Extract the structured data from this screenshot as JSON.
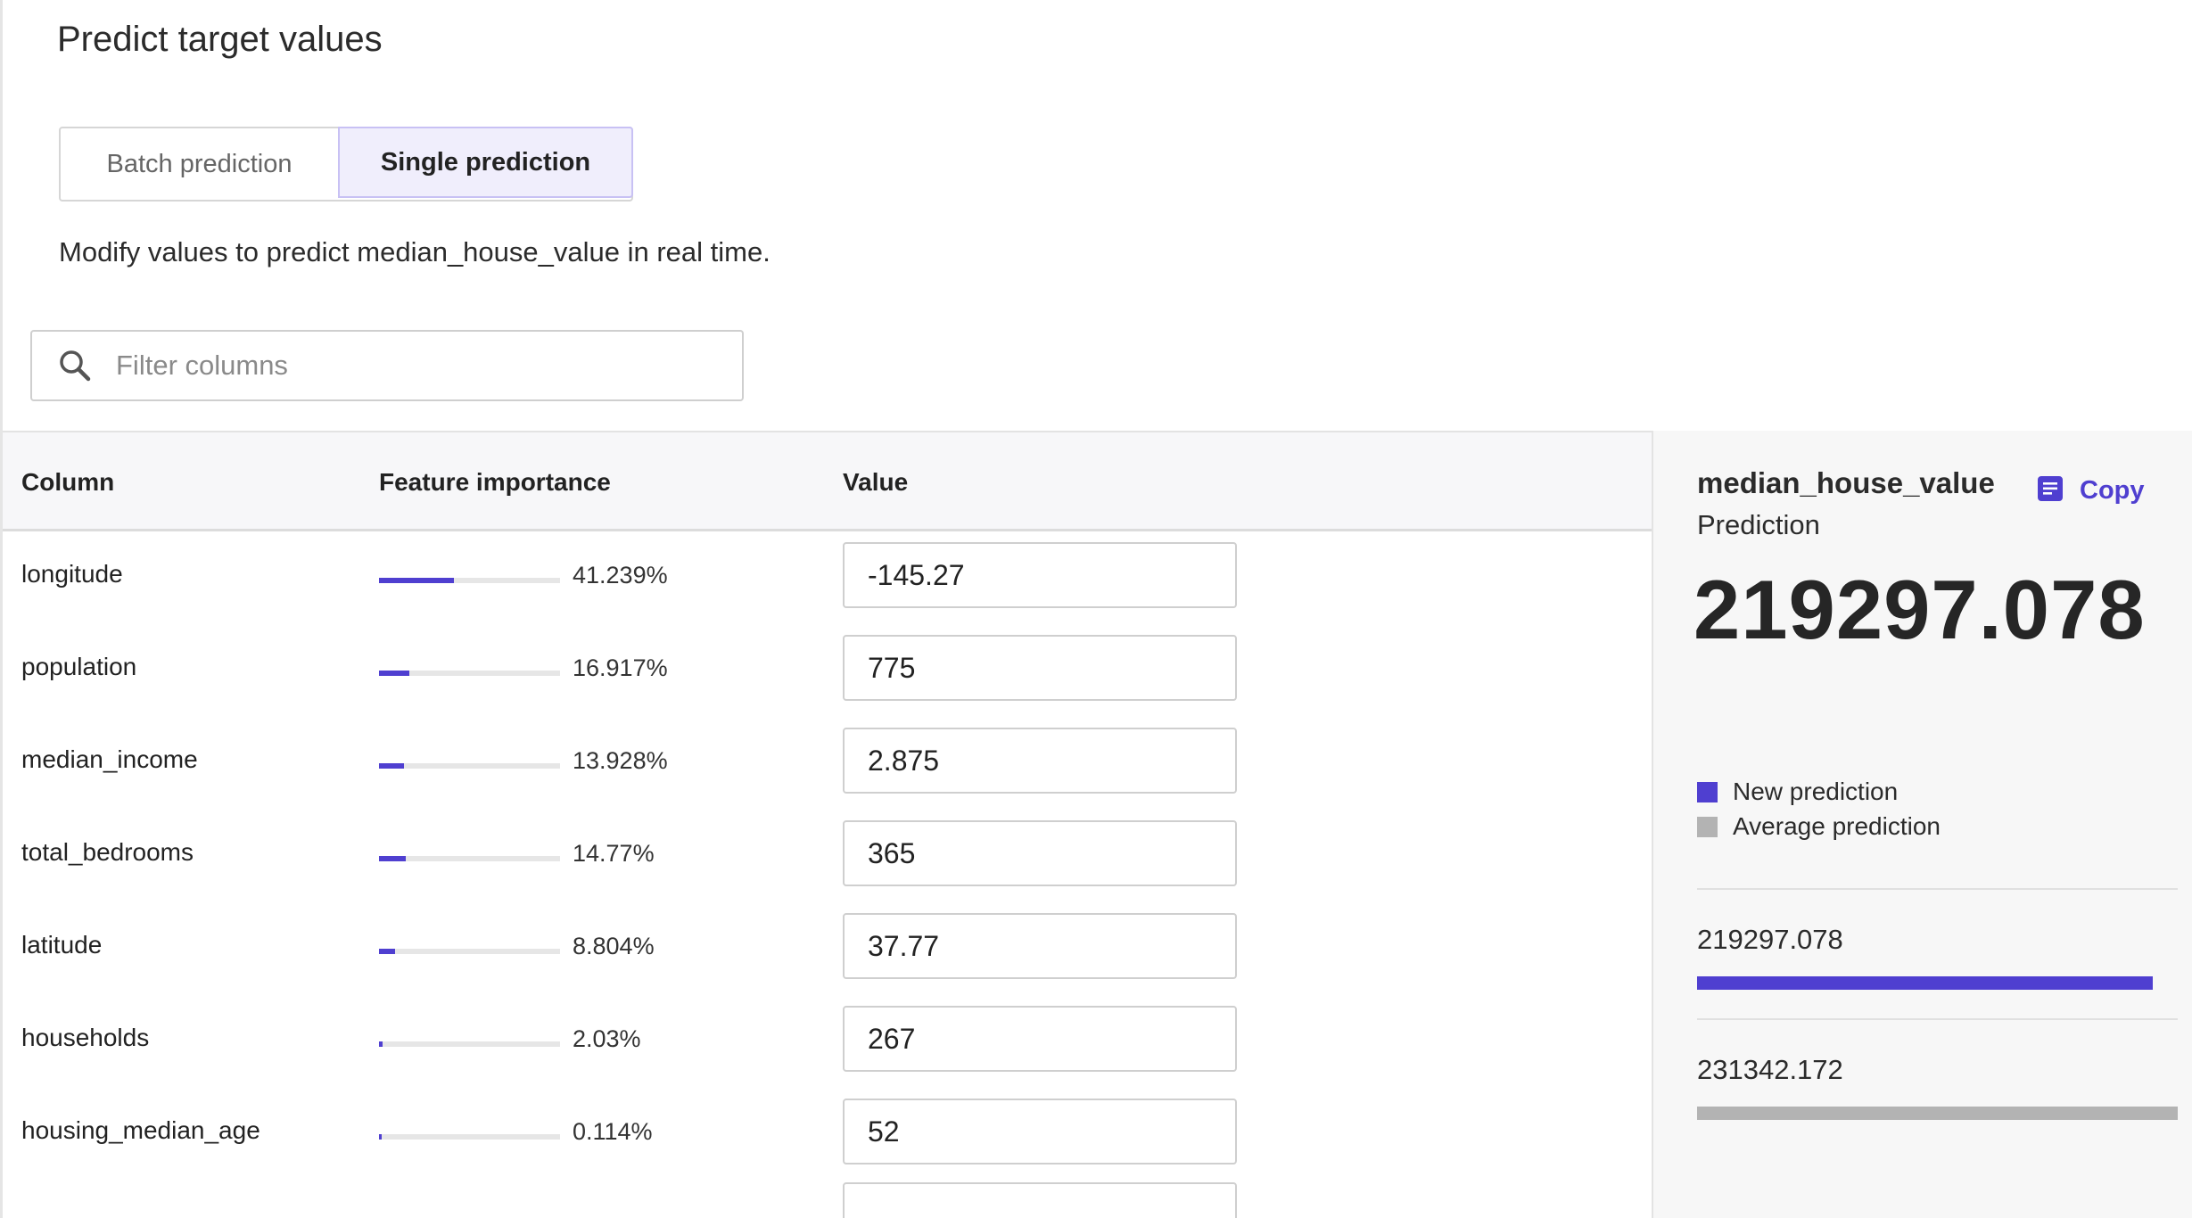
{
  "header": {
    "title": "Predict target values"
  },
  "mode_tabs": {
    "batch_label": "Batch prediction",
    "single_label": "Single prediction",
    "selected": "Single prediction"
  },
  "description": "Modify values to predict median_house_value in real time.",
  "filter": {
    "placeholder": "Filter columns",
    "value": ""
  },
  "table": {
    "headers": {
      "column": "Column",
      "importance": "Feature importance",
      "value": "Value"
    },
    "rows": [
      {
        "name": "longitude",
        "importance_pct": 41.239,
        "importance_label": "41.239%",
        "value": "-145.27"
      },
      {
        "name": "population",
        "importance_pct": 16.917,
        "importance_label": "16.917%",
        "value": "775"
      },
      {
        "name": "median_income",
        "importance_pct": 13.928,
        "importance_label": "13.928%",
        "value": "2.875"
      },
      {
        "name": "total_bedrooms",
        "importance_pct": 14.77,
        "importance_label": "14.77%",
        "value": "365"
      },
      {
        "name": "latitude",
        "importance_pct": 8.804,
        "importance_label": "8.804%",
        "value": "37.77"
      },
      {
        "name": "households",
        "importance_pct": 2.03,
        "importance_label": "2.03%",
        "value": "267"
      },
      {
        "name": "housing_median_age",
        "importance_pct": 0.114,
        "importance_label": "0.114%",
        "value": "52"
      },
      {
        "name": "",
        "importance_pct": null,
        "importance_label": "",
        "value": ""
      }
    ]
  },
  "prediction_panel": {
    "target": "median_house_value",
    "copy_label": "Copy",
    "copy_icon": "copy-icon",
    "prediction_label": "Prediction",
    "prediction_value": "219297.078",
    "legend": [
      {
        "label": "New prediction",
        "color": "#4f3fd0"
      },
      {
        "label": "Average prediction",
        "color": "#b3b3b3"
      }
    ],
    "comparison": [
      {
        "value_label": "219297.078",
        "value": 219297.078,
        "color": "#4f3fd0"
      },
      {
        "value_label": "231342.172",
        "value": 231342.172,
        "color": "#b3b3b3"
      }
    ]
  },
  "colors": {
    "accent": "#4f3fd0",
    "selected_tab_bg": "#f0eefc",
    "panel_bg": "#f7f7f7"
  }
}
